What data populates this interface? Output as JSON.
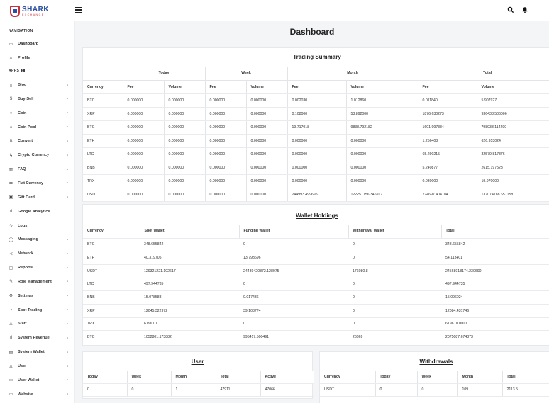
{
  "brand": {
    "name": "SHARK",
    "tagline": "EXCHANGE"
  },
  "icons": {
    "menu": "hamburger-icon",
    "search": "search-icon",
    "notifications": "bell-icon"
  },
  "sidebar": {
    "navigation_label": "NAVIGATION",
    "apps_label": "APPS",
    "apps_count": "1",
    "top_items": [
      {
        "label": "Dashboard",
        "icon": "monitor-icon"
      },
      {
        "label": "Profile",
        "icon": "user-icon"
      }
    ],
    "items": [
      {
        "label": "Blog",
        "icon": "file-icon"
      },
      {
        "label": "Buy-Sell",
        "icon": "dollar-icon"
      },
      {
        "label": "Coin",
        "icon": "circle-icon"
      },
      {
        "label": "Coin Pool",
        "icon": "bank-icon"
      },
      {
        "label": "Convert",
        "icon": "swap-icon"
      },
      {
        "label": "Crypto Currency",
        "icon": "arrow-corner-icon"
      },
      {
        "label": "FAQ",
        "icon": "book-icon"
      },
      {
        "label": "Fiat Currency",
        "icon": "list-icon"
      },
      {
        "label": "Gift Card",
        "icon": "gift-icon"
      },
      {
        "label": "Google Analytics",
        "icon": "bar-chart-icon"
      },
      {
        "label": "Logs",
        "icon": "activity-icon"
      },
      {
        "label": "Messaging",
        "icon": "message-icon"
      },
      {
        "label": "Network",
        "icon": "share-icon"
      },
      {
        "label": "Reports",
        "icon": "report-icon"
      },
      {
        "label": "Role Management",
        "icon": "edit-icon"
      },
      {
        "label": "Settings",
        "icon": "gear-icon"
      },
      {
        "label": "Spot Trading",
        "icon": "clock-icon"
      },
      {
        "label": "Staff",
        "icon": "users-icon"
      },
      {
        "label": "System Revenue",
        "icon": "bar-chart-icon"
      },
      {
        "label": "System Wallet",
        "icon": "wallet-icon"
      },
      {
        "label": "User",
        "icon": "user-icon"
      },
      {
        "label": "User Wallet",
        "icon": "credit-card-icon"
      },
      {
        "label": "Website",
        "icon": "monitor-icon"
      }
    ]
  },
  "main": {
    "title": "Dashboard",
    "trading_summary": {
      "title": "Trading Summary",
      "groups": [
        "Today",
        "Week",
        "Month",
        "Total"
      ],
      "columns": [
        "Currency",
        "Fee",
        "Volume",
        "Fee",
        "Volume",
        "Fee",
        "Volume",
        "Fee",
        "Volume"
      ],
      "rows": [
        [
          "BTC",
          "0.000000",
          "0.000000",
          "0.000000",
          "0.000000",
          "0.002030",
          "1.012860",
          "0.011840",
          "5.907927"
        ],
        [
          "XRP",
          "0.000000",
          "0.000000",
          "0.000000",
          "0.000000",
          "0.108000",
          "53.892000",
          "1876.630273",
          "936438.506006"
        ],
        [
          "BTC",
          "0.000000",
          "0.000000",
          "0.000000",
          "0.000000",
          "19.717018",
          "9838.792182",
          "1601.997384",
          "798938.114290"
        ],
        [
          "ETH",
          "0.000000",
          "0.000000",
          "0.000000",
          "0.000000",
          "0.000000",
          "0.000000",
          "1.256408",
          "626.953024"
        ],
        [
          "LTC",
          "0.000000",
          "0.000000",
          "0.000000",
          "0.000000",
          "0.000000",
          "0.000000",
          "65.290215",
          "32579.817376"
        ],
        [
          "BNB",
          "0.000000",
          "0.000000",
          "0.000000",
          "0.000000",
          "0.000000",
          "0.000000",
          "5.240877",
          "2615.197523"
        ],
        [
          "TRX",
          "0.000000",
          "0.000000",
          "0.000000",
          "0.000000",
          "0.000000",
          "0.000000",
          "0.030000",
          "19.970000"
        ],
        [
          "USDT",
          "0.000000",
          "0.000000",
          "0.000000",
          "0.000000",
          "244993.499695",
          "122251756.346917",
          "274697.404104",
          "137074788.657158"
        ]
      ]
    },
    "wallet_holdings": {
      "title": "Wallet Holdings",
      "columns": [
        "Currency",
        "Spot Wallet",
        "Funding Wallet",
        "Withdrawal Wallet",
        "Total"
      ],
      "rows": [
        [
          "BTC",
          "348.655842",
          "0",
          "0",
          "348.655842"
        ],
        [
          "ETH",
          "40.319705",
          "13.793696",
          "0",
          "54.113401"
        ],
        [
          "USDT",
          "129321221.102617",
          "24439420872.128075",
          "176080.8",
          "24568918174.230690"
        ],
        [
          "LTC",
          "497.944735",
          "0",
          "0",
          "497.944735"
        ],
        [
          "BNB",
          "15.078588",
          "0.017436",
          "0",
          "15.096024"
        ],
        [
          "XRP",
          "12045.322972",
          "39.108774",
          "0",
          "12084.431746"
        ],
        [
          "TRX",
          "6196.01",
          "0",
          "0",
          "6196.010000"
        ],
        [
          "BTC",
          "1052801.173882",
          "995417.500491",
          "26869",
          "2075087.674373"
        ]
      ]
    },
    "user": {
      "title": "User",
      "columns": [
        "Today",
        "Week",
        "Month",
        "Total",
        "Active"
      ],
      "rows": [
        [
          "0",
          "0",
          "1",
          "47911",
          "47066"
        ]
      ]
    },
    "withdrawals": {
      "title": "Withdrawals",
      "columns": [
        "Currency",
        "Today",
        "Week",
        "Month",
        "Total"
      ],
      "rows": [
        [
          "USDT",
          "0",
          "0",
          "109",
          "2113.5"
        ]
      ]
    }
  }
}
